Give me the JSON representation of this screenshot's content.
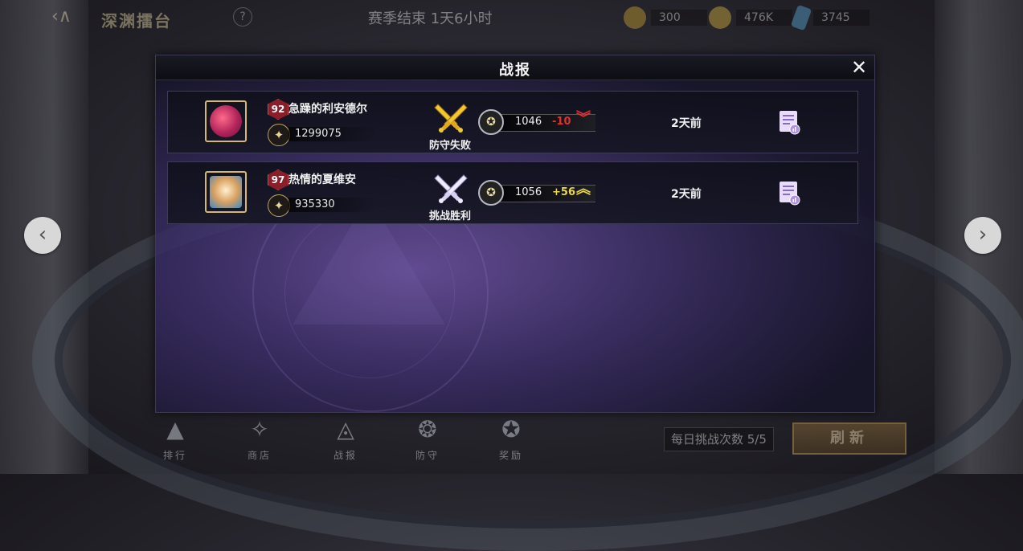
{
  "topbar": {
    "back_glyph": "‹∧",
    "title": "深渊擂台",
    "help_glyph": "?",
    "season_text": "赛季结束 1天6小时",
    "currencies": [
      {
        "icon": "gold-medal-icon",
        "value": "300",
        "color": "#c8a030"
      },
      {
        "icon": "gold-coin-icon",
        "value": "476K",
        "color": "#d4b040"
      },
      {
        "icon": "blue-crystal-icon",
        "value": "3745",
        "color": "#5aa8d8"
      }
    ]
  },
  "modal": {
    "title": "战报",
    "close_glyph": "✕"
  },
  "reports": [
    {
      "avatar_icon": "red-berries-icon",
      "avatar_color": "#b0245a",
      "level": "92",
      "name": "急躁的利安德尔",
      "power": "1299075",
      "battle_icon": "crossed-swords-gold-icon",
      "result": "防守失败",
      "rank": "1046",
      "delta": "-10",
      "delta_color": "#e03030",
      "arrow": "︾",
      "arrow_icon": "double-chevron-down-icon",
      "time_ago": "2天前"
    },
    {
      "avatar_icon": "golden-cup-icon",
      "avatar_color": "#d8a060",
      "level": "97",
      "name": "热情的夏维安",
      "power": "935330",
      "battle_icon": "crossed-swords-silver-icon",
      "result": "挑战胜利",
      "rank": "1056",
      "delta": "+56",
      "delta_color": "#e8d84a",
      "arrow": "︽",
      "arrow_icon": "double-chevron-up-icon",
      "time_ago": "2天前"
    }
  ],
  "nav": {
    "prev_glyph": "‹",
    "next_glyph": "›"
  },
  "bottom_tabs": [
    {
      "icon": "ranking-icon",
      "label": "排行"
    },
    {
      "icon": "shop-icon",
      "label": "商店"
    },
    {
      "icon": "battle-report-icon",
      "label": "战报"
    },
    {
      "icon": "defense-icon",
      "label": "防守"
    },
    {
      "icon": "reward-icon",
      "label": "奖励"
    }
  ],
  "daily_challenges": "每日挑战次数 5/5",
  "refresh_label": "刷新",
  "colors": {
    "gold": "#d6b86a",
    "modal_purple": "#6e50aa",
    "loss_red": "#e03030",
    "win_yellow": "#e8d84a"
  }
}
